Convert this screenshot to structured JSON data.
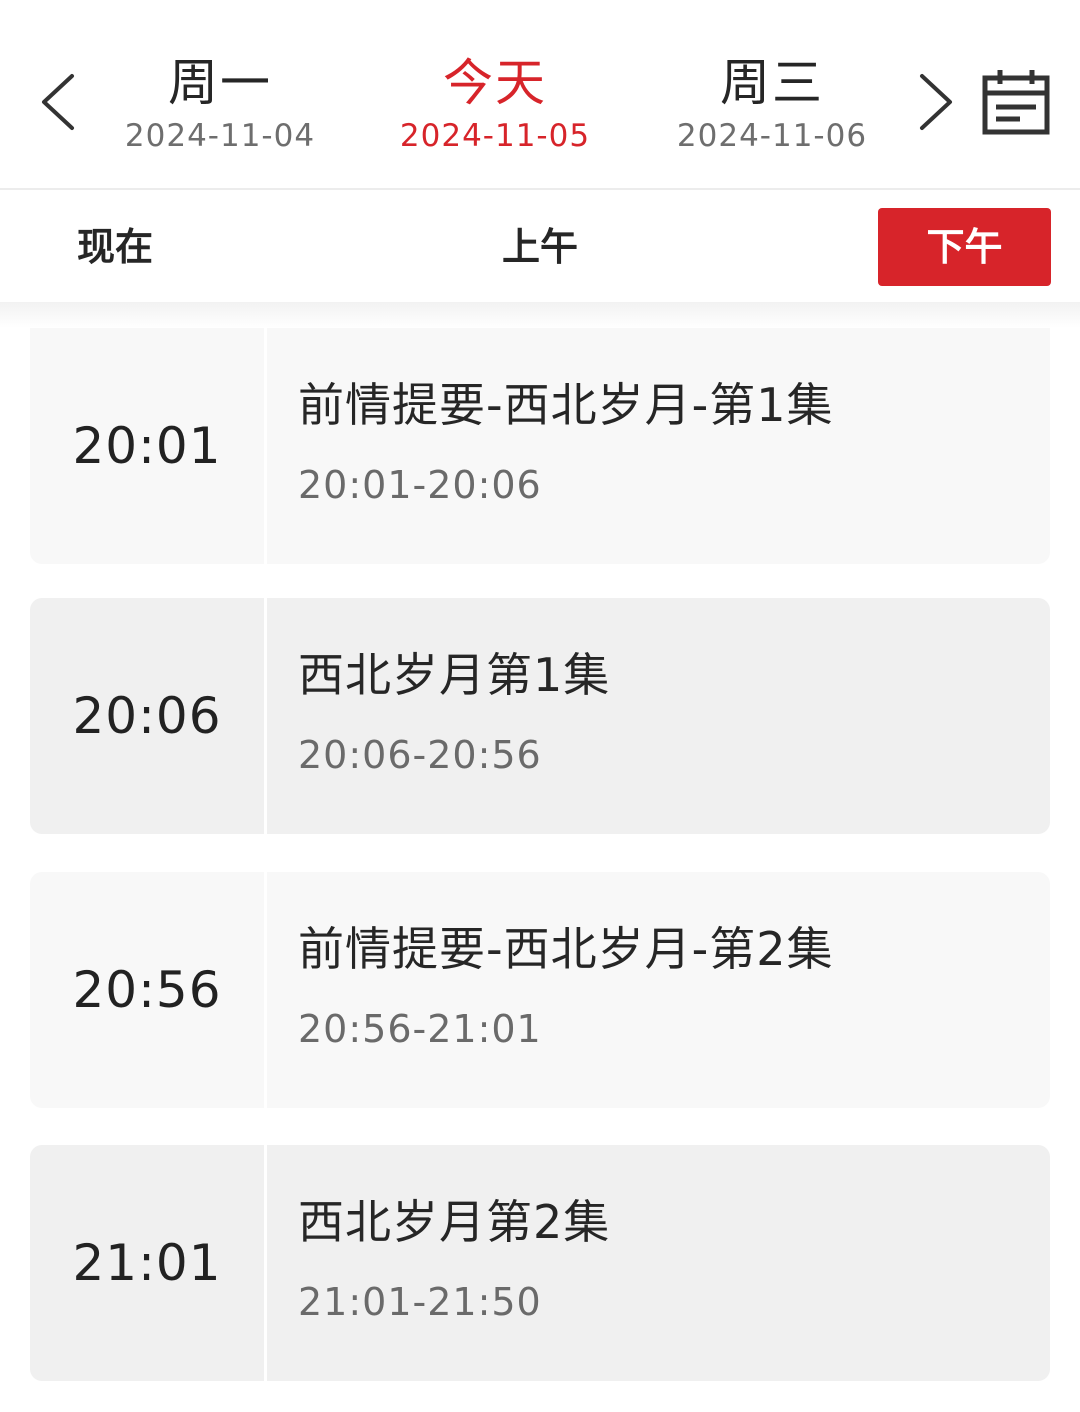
{
  "date_nav": {
    "prev_icon": "chevron-left-icon",
    "next_icon": "chevron-right-icon",
    "calendar_icon": "calendar-icon",
    "days": [
      {
        "weekday": "周一",
        "date": "2024-11-04",
        "active": false
      },
      {
        "weekday": "今天",
        "date": "2024-11-05",
        "active": true
      },
      {
        "weekday": "周三",
        "date": "2024-11-06",
        "active": false
      }
    ]
  },
  "period_tabs": {
    "now": "现在",
    "am": "上午",
    "pm": "下午",
    "selected": "pm"
  },
  "programs": [
    {
      "start": "20:01",
      "title": "前情提要-西北岁月-第1集",
      "range": "20:01-20:06"
    },
    {
      "start": "20:06",
      "title": "西北岁月第1集",
      "range": "20:06-20:56"
    },
    {
      "start": "20:56",
      "title": "前情提要-西北岁月-第2集",
      "range": "20:56-21:01"
    },
    {
      "start": "21:01",
      "title": "西北岁月第2集",
      "range": "21:01-21:50"
    }
  ],
  "colors": {
    "accent": "#d7242a",
    "text": "#262626",
    "muted": "#6e6e6e",
    "card_light": "#f8f8f8",
    "card_dark": "#f0f0f0"
  }
}
